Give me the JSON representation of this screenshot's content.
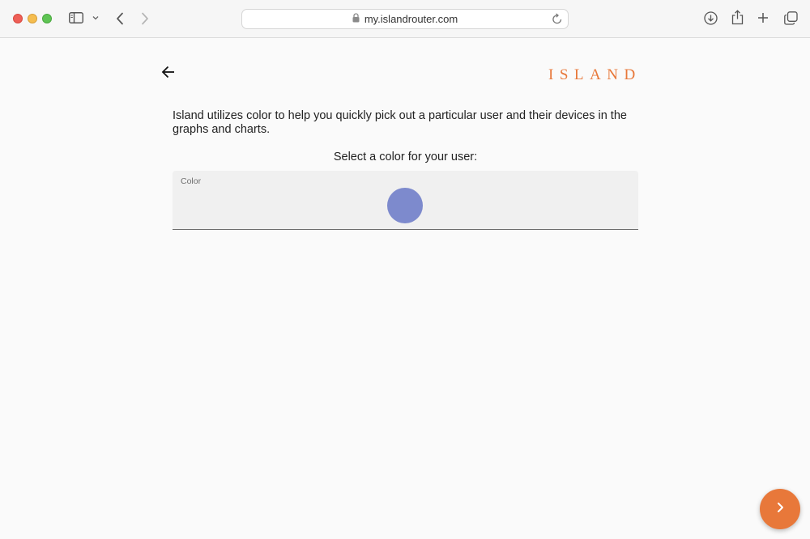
{
  "browser": {
    "url": "my.islandrouter.com",
    "icons": {
      "close": "close-dot",
      "minimize": "minimize-dot",
      "zoom": "zoom-dot",
      "sidebar": "sidebar-icon",
      "chevron": "chevron-down-icon",
      "back": "back-icon",
      "forward": "forward-icon",
      "lock": "lock-icon",
      "reload": "reload-icon",
      "download": "download-icon",
      "share": "share-icon",
      "new_tab": "plus-icon",
      "tabs": "tabs-icon"
    }
  },
  "page": {
    "brand": "ISLAND",
    "brand_color": "#e8783a",
    "intro": "Island utilizes color to help you quickly pick out a particular user and their devices in the graphs and charts.",
    "prompt": "Select a color for your user:",
    "color_field": {
      "label": "Color",
      "selected_color": "#7d8acd"
    },
    "next_button_icon": "chevron-right-icon"
  }
}
